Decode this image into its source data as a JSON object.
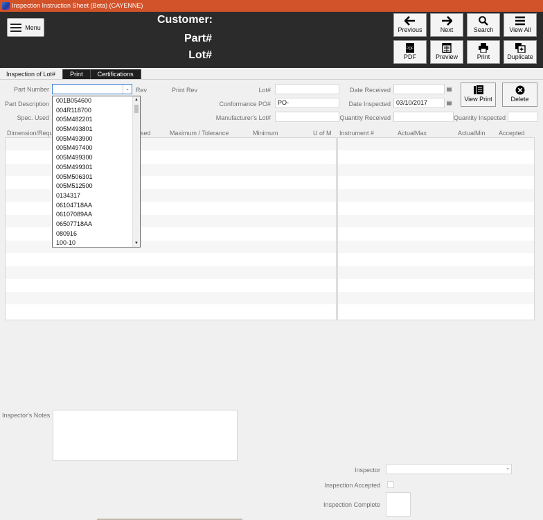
{
  "window": {
    "title": "Inspection Instruction Sheet (Beta) (CAYENNE)"
  },
  "header": {
    "menu_label": "Menu",
    "customer_label": "Customer:",
    "part_label": "Part#",
    "lot_label": "Lot#"
  },
  "toolbar": {
    "previous": "Previous",
    "next": "Next",
    "search": "Search",
    "view_all": "View All",
    "pdf": "PDF",
    "preview": "Preview",
    "print": "Print",
    "duplicate": "Duplicate"
  },
  "tabs": [
    "Inspection of Lot#",
    "Print",
    "Certifications"
  ],
  "form": {
    "part_number_label": "Part Number",
    "part_number_value": "",
    "rev_label": "Rev",
    "print_rev_label": "Print Rev",
    "part_description_label": "Part Description",
    "spec_used_label": "Spec. Used",
    "lot_label": "Lot#",
    "lot_value": "",
    "conformance_po_label": "Conformance PO#",
    "conformance_po_value": "PO-",
    "manufacturer_lot_label": "Manufacturer's Lot#",
    "manufacturer_lot_value": "",
    "date_received_label": "Date Received",
    "date_received_value": "",
    "date_inspected_label": "Date Inspected",
    "date_inspected_value": "03/10/2017",
    "quantity_received_label": "Quantity Received",
    "quantity_received_value": "",
    "quantity_inspected_label": "Quantity Inspected",
    "quantity_inspected_value": "",
    "view_print_label": "View Print",
    "delete_label": "Delete"
  },
  "left_grid": {
    "columns": [
      "Dimension/Requ",
      "sed",
      "Maximum / Tolerance",
      "Minimum",
      "U of M"
    ],
    "row_count": 14
  },
  "right_grid": {
    "columns": [
      "Instrument #",
      "ActualMax",
      "ActualMin",
      "Accepted"
    ],
    "row_count": 14
  },
  "part_number_dropdown": {
    "options": [
      "001B054600",
      "004R118700",
      "005M482201",
      "005M493801",
      "005M493900",
      "005M497400",
      "005M499300",
      "005M499301",
      "005M506301",
      "005M512500",
      "0134317",
      "06104718AA",
      "06107089AA",
      "06507718AA",
      "080916",
      "100-10"
    ]
  },
  "footer": {
    "inspectors_notes_label": "Inspector's Notes",
    "inspector_label": "Inspector",
    "inspection_accepted_label": "Inspection Accepted",
    "inspection_complete_label": "Inspection Complete"
  },
  "colors": {
    "titlebar": "#d2522a",
    "header_bg": "#2b2b2b",
    "focus_border": "#3c7fd6"
  }
}
